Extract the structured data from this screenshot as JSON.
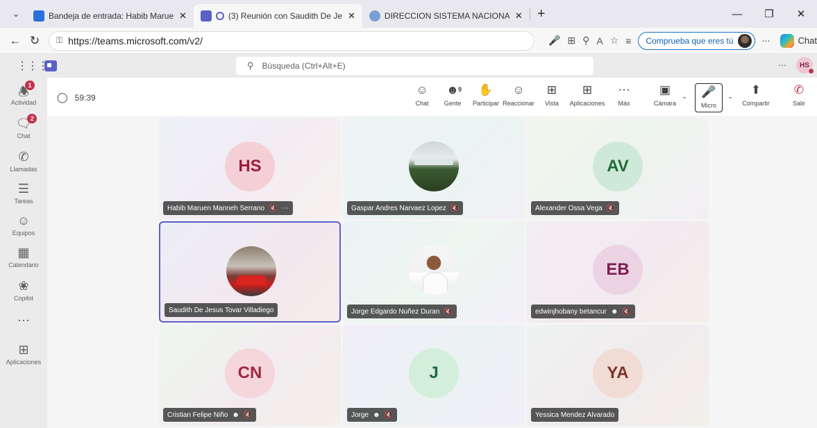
{
  "browser": {
    "tabs": [
      {
        "title": "Bandeja de entrada: Habib Maruen",
        "favicon_color": "#2a6fdb",
        "active": false
      },
      {
        "title": "(3) Reunión con Saudith De Je",
        "favicon_color": "#5b5fc7",
        "active": true
      },
      {
        "title": "DIRECCION SISTEMA NACIONAL D",
        "favicon_color": "#7a9fd6",
        "active": false
      }
    ],
    "url": "https://teams.microsoft.com/v2/",
    "verify_label": "Comprueba que eres tú",
    "copilot_label": "Chat"
  },
  "teams": {
    "search_placeholder": "Búsqueda (Ctrl+Alt+E)",
    "user_initials": "HS",
    "rail": [
      {
        "label": "Actividad",
        "icon": "bell-icon",
        "badge": "1"
      },
      {
        "label": "Chat",
        "icon": "chat-icon",
        "badge": "2"
      },
      {
        "label": "Llamadas",
        "icon": "phone-icon",
        "badge": ""
      },
      {
        "label": "Tareas",
        "icon": "tasks-icon",
        "badge": ""
      },
      {
        "label": "Equipos",
        "icon": "teams-icon",
        "badge": ""
      },
      {
        "label": "Calendario",
        "icon": "calendar-icon",
        "badge": ""
      },
      {
        "label": "Copilot",
        "icon": "copilot-icon",
        "badge": ""
      },
      {
        "label": "",
        "icon": "more-icon",
        "badge": ""
      },
      {
        "label": "Aplicaciones",
        "icon": "add-app-icon",
        "badge": ""
      }
    ]
  },
  "meeting": {
    "timer": "59:39",
    "people_count": "9",
    "toolbar": {
      "chat": "Chat",
      "people": "Gente",
      "raise": "Participar",
      "react": "Reaccionar",
      "view": "Vista",
      "apps": "Aplicaciones",
      "more": "Más",
      "camera": "Cámara",
      "mic": "Micro",
      "share": "Compartir",
      "leave": "Salir"
    },
    "participants": [
      {
        "name": "Habib Maruen Manneh Serrano",
        "initials": "HS",
        "muted": true,
        "more": true
      },
      {
        "name": "Gaspar Andres Narvaez Lopez",
        "initials": "",
        "muted": true
      },
      {
        "name": "Alexander Ossa Vega",
        "initials": "AV",
        "muted": true
      },
      {
        "name": "Saudith De Jesus Tovar Villadiego",
        "initials": "",
        "muted": false
      },
      {
        "name": "Jorge Edgardo Nuñez Duran",
        "initials": "",
        "muted": true
      },
      {
        "name": "edwinjhobany betancur",
        "initials": "EB",
        "muted": true,
        "external": true
      },
      {
        "name": "Cristian Felipe Niño",
        "initials": "CN",
        "muted": true,
        "external": true
      },
      {
        "name": "Jorge",
        "initials": "J",
        "muted": true,
        "external": true
      },
      {
        "name": "Yessica Mendez Alvarado",
        "initials": "YA",
        "muted": false
      }
    ]
  },
  "colors": {
    "accent": "#5b5fc7",
    "notification": "#c4314b",
    "leave": "#c4314b"
  }
}
